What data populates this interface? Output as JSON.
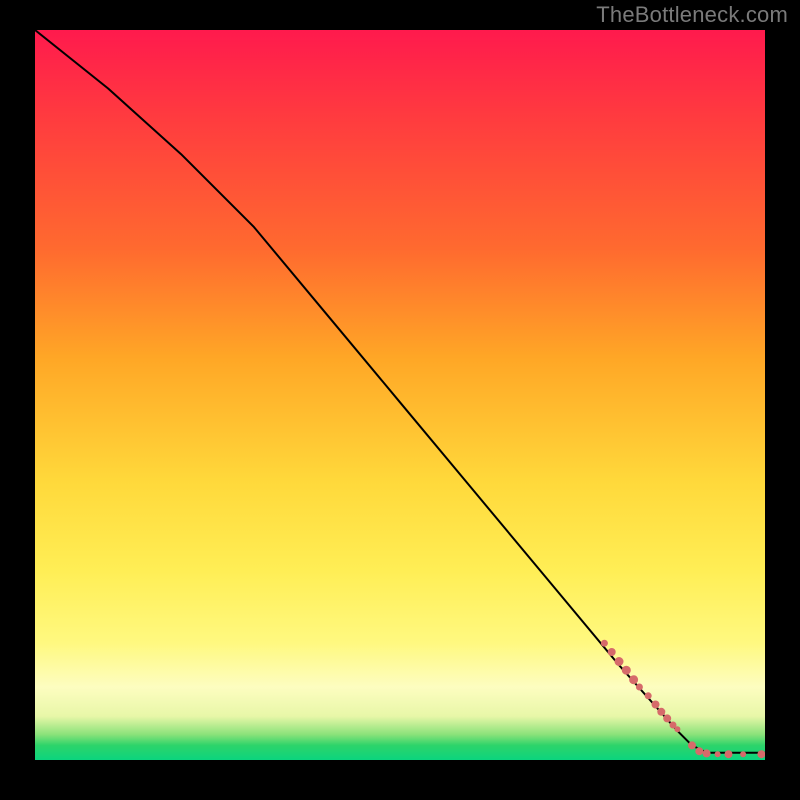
{
  "watermark": "TheBottleneck.com",
  "chart_data": {
    "type": "line",
    "title": "",
    "xlabel": "",
    "ylabel": "",
    "xlim": [
      0,
      100
    ],
    "ylim": [
      0,
      100
    ],
    "grid": false,
    "legend": false,
    "series": [
      {
        "name": "curve",
        "kind": "line",
        "x": [
          0,
          10,
          20,
          30,
          40,
          50,
          60,
          70,
          80,
          88,
          90,
          92,
          95,
          100
        ],
        "y": [
          100,
          92,
          83,
          73,
          61,
          49,
          37,
          25,
          13,
          4,
          2,
          1,
          1,
          1
        ]
      },
      {
        "name": "markers",
        "kind": "scatter",
        "points": [
          {
            "x": 78.0,
            "y": 16.0,
            "r": 3.5
          },
          {
            "x": 79.0,
            "y": 14.8,
            "r": 4.0
          },
          {
            "x": 80.0,
            "y": 13.5,
            "r": 4.5
          },
          {
            "x": 81.0,
            "y": 12.3,
            "r": 4.5
          },
          {
            "x": 82.0,
            "y": 11.0,
            "r": 4.5
          },
          {
            "x": 82.8,
            "y": 10.0,
            "r": 3.5
          },
          {
            "x": 84.0,
            "y": 8.8,
            "r": 3.5
          },
          {
            "x": 85.0,
            "y": 7.6,
            "r": 4.0
          },
          {
            "x": 85.8,
            "y": 6.6,
            "r": 4.0
          },
          {
            "x": 86.6,
            "y": 5.7,
            "r": 4.0
          },
          {
            "x": 87.4,
            "y": 4.8,
            "r": 3.5
          },
          {
            "x": 88.0,
            "y": 4.2,
            "r": 3.0
          },
          {
            "x": 90.0,
            "y": 2.0,
            "r": 4.0
          },
          {
            "x": 91.0,
            "y": 1.2,
            "r": 4.0
          },
          {
            "x": 92.0,
            "y": 0.9,
            "r": 4.0
          },
          {
            "x": 93.5,
            "y": 0.8,
            "r": 3.0
          },
          {
            "x": 95.0,
            "y": 0.8,
            "r": 4.0
          },
          {
            "x": 97.0,
            "y": 0.8,
            "r": 3.0
          },
          {
            "x": 99.5,
            "y": 0.8,
            "r": 4.0
          }
        ]
      }
    ],
    "background_gradient": {
      "stops": [
        {
          "pos": 0,
          "color": "#ff1a4d"
        },
        {
          "pos": 45,
          "color": "#ffa726"
        },
        {
          "pos": 74,
          "color": "#ffee55"
        },
        {
          "pos": 94,
          "color": "#e8f7a8"
        },
        {
          "pos": 100,
          "color": "#0bd47e"
        }
      ]
    }
  }
}
